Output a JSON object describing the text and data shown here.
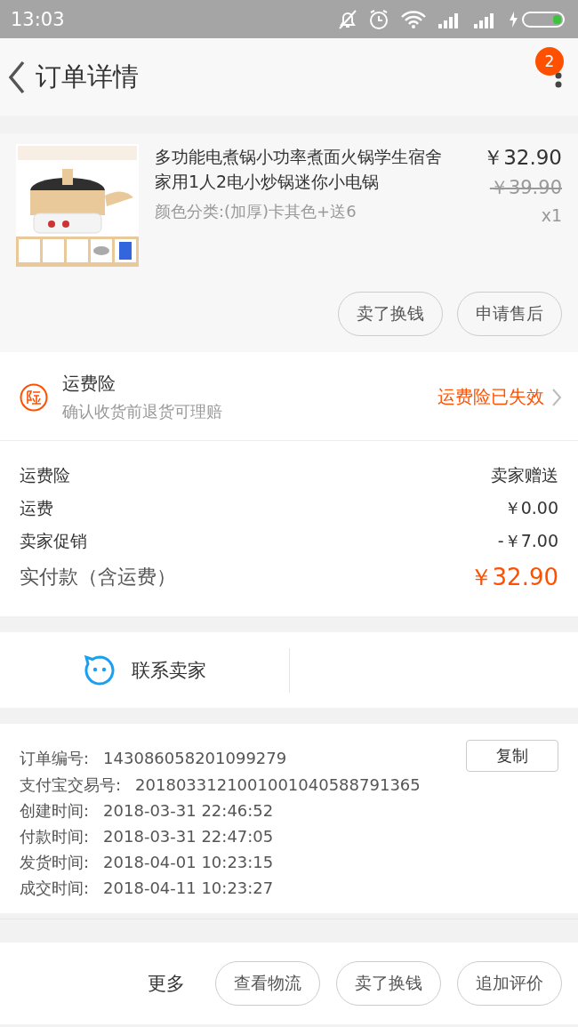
{
  "status_bar": {
    "time": "13:03"
  },
  "header": {
    "title": "订单详情",
    "badge": "2"
  },
  "product": {
    "title": "多功能电煮锅小功率煮面火锅学生宿舍家用1人2电小炒锅迷你小电锅",
    "variant": "颜色分类:(加厚)卡其色+送6",
    "price": "￥32.90",
    "original_price": "￥39.90",
    "quantity": "x1",
    "buttons": [
      "卖了换钱",
      "申请售后"
    ]
  },
  "insurance": {
    "title": "运费险",
    "subtitle": "确认收货前退货可理赔",
    "status": "运费险已失效"
  },
  "fees": [
    {
      "label": "运费险",
      "value": "卖家赠送",
      "kind": "plain"
    },
    {
      "label": "运费",
      "value": "￥0.00",
      "kind": "plain"
    },
    {
      "label": "卖家促销",
      "value": "-￥7.00",
      "kind": "plain"
    },
    {
      "label": "实付款（含运费）",
      "value": "￥32.90",
      "kind": "total"
    }
  ],
  "contact": {
    "label": "联系卖家"
  },
  "order_info": {
    "copy_button": "复制",
    "rows": [
      {
        "label": "订单编号:",
        "value": "143086058201099279"
      },
      {
        "label": "支付宝交易号:",
        "value": "2018033121001001040588791365"
      },
      {
        "label": "创建时间:",
        "value": "2018-03-31 22:46:52"
      },
      {
        "label": "付款时间:",
        "value": "2018-03-31 22:47:05"
      },
      {
        "label": "发货时间:",
        "value": "2018-04-01 10:23:15"
      },
      {
        "label": "成交时间:",
        "value": "2018-04-11 10:23:27"
      }
    ]
  },
  "bottom_bar": {
    "more": "更多",
    "buttons": [
      "查看物流",
      "卖了换钱",
      "追加评价"
    ]
  }
}
